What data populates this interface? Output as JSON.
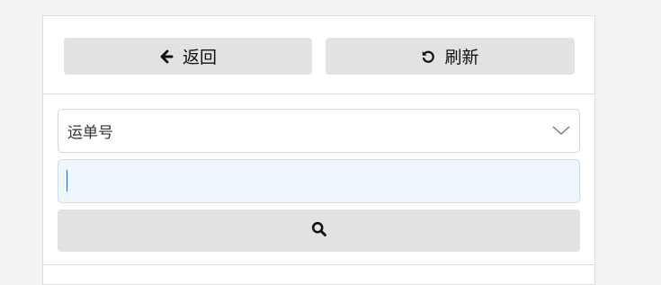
{
  "toolbar": {
    "back_label": "返回",
    "refresh_label": "刷新",
    "back_icon": "arrow-left-icon",
    "refresh_icon": "rotate-ccw-icon"
  },
  "search_form": {
    "select_value": "运单号",
    "input_value": "",
    "search_icon": "search-icon"
  },
  "colors": {
    "page_bg": "#f3f3f3",
    "button_bg": "#e2e2e2",
    "input_bg": "#eef6fe"
  }
}
